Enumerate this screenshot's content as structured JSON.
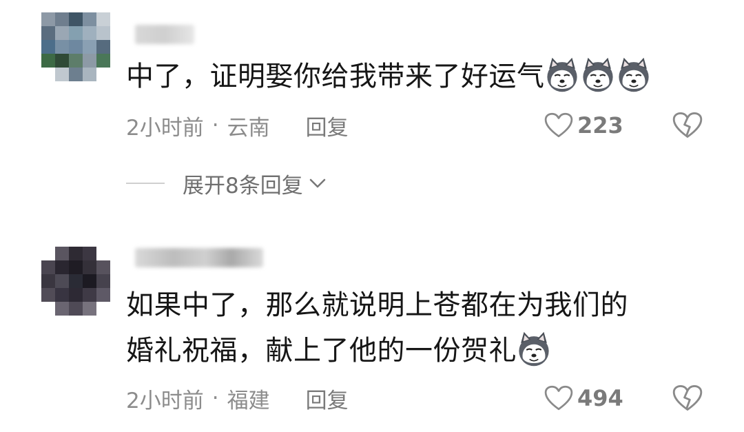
{
  "comments": [
    {
      "text": "中了，证明娶你给我带来了好运气",
      "emoji": "husky-smirk-icon",
      "emoji_count": 3,
      "time": "2小时前",
      "location": "云南",
      "reply_label": "回复",
      "likes": "223",
      "expand_label": "展开8条回复"
    },
    {
      "line1": "如果中了，那么就说明上苍都在为我们的",
      "line2": "婚礼祝福，献上了他的一份贺礼",
      "emoji": "husky-smirk-icon",
      "emoji_count": 1,
      "time": "2小时前",
      "location": "福建",
      "reply_label": "回复",
      "likes": "494"
    }
  ],
  "separator": "·"
}
